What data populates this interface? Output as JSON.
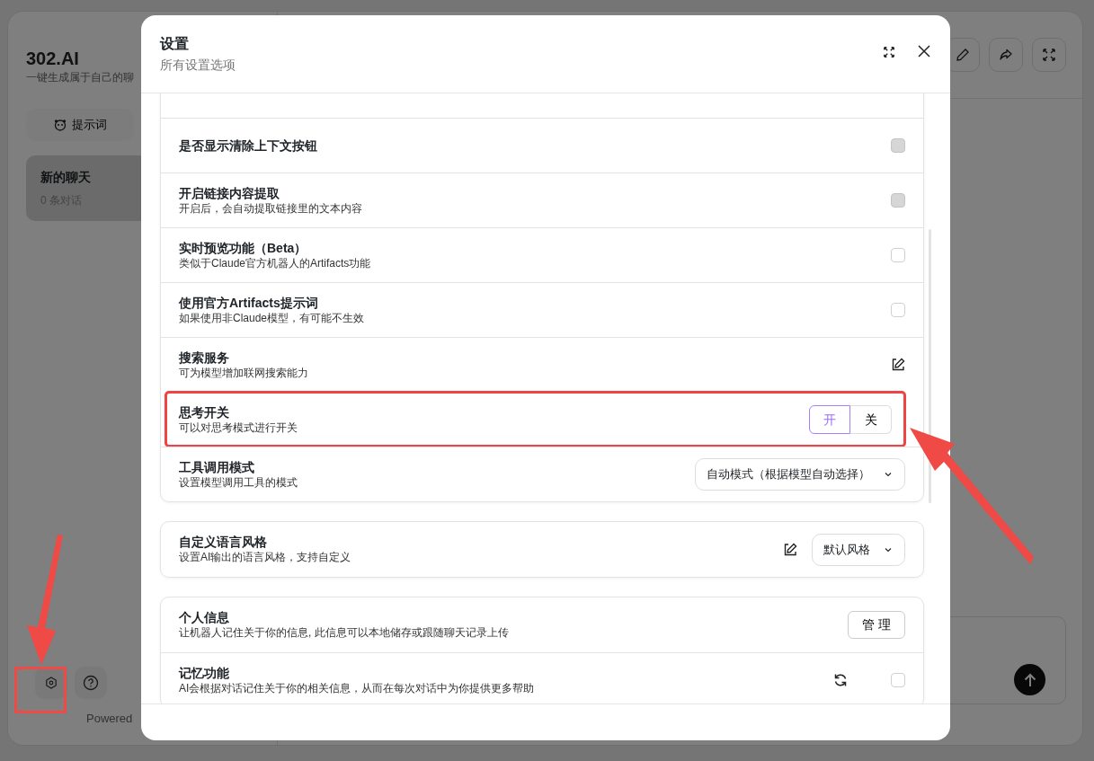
{
  "sidebar": {
    "title": "302.AI",
    "subtitle": "一键生成属于自己的聊",
    "prompt_button": "提示词",
    "chats": [
      {
        "title": "新的聊天",
        "count": "0 条对话",
        "selected": true
      }
    ],
    "footer": "Powered"
  },
  "dialog": {
    "title": "设置",
    "subtitle": "所有设置选项",
    "groups": [
      {
        "rows": [
          {
            "kind": "checkbox",
            "title": "是否显示清除上下文按钮",
            "checked": false,
            "disabled": true,
            "highlighted": false
          },
          {
            "kind": "checkbox",
            "title": "开启链接内容提取",
            "description": "开启后，会自动提取链接里的文本内容",
            "checked": false,
            "disabled": true,
            "highlighted": false
          },
          {
            "kind": "checkbox",
            "title": "实时预览功能（Beta）",
            "description": "类似于Claude官方机器人的Artifacts功能",
            "checked": false,
            "disabled": false,
            "highlighted": false
          },
          {
            "kind": "checkbox",
            "title": "使用官方Artifacts提示词",
            "description": "如果使用非Claude模型，有可能不生效",
            "checked": false,
            "disabled": false,
            "highlighted": false
          },
          {
            "kind": "edit",
            "title": "搜索服务",
            "description": "可为模型增加联网搜索能力",
            "highlighted": false
          },
          {
            "kind": "segmented",
            "title": "思考开关",
            "description": "可以对思考模式进行开关",
            "highlighted": true,
            "options": [
              {
                "label": "开",
                "selected": true
              },
              {
                "label": "关",
                "selected": false
              }
            ]
          },
          {
            "kind": "select",
            "title": "工具调用模式",
            "description": "设置模型调用工具的模式",
            "value": "自动模式（根据模型自动选择）",
            "highlighted": false
          }
        ]
      },
      {
        "rows": [
          {
            "kind": "edit_select",
            "title": "自定义语言风格",
            "description": "设置AI输出的语言风格，支持自定义",
            "value": "默认风格",
            "highlighted": false
          }
        ]
      },
      {
        "rows": [
          {
            "kind": "button",
            "title": "个人信息",
            "description": "让机器人记住关于你的信息, 此信息可以本地储存或跟随聊天记录上传",
            "button": "管 理",
            "highlighted": false
          },
          {
            "kind": "refresh_checkbox",
            "title": "记忆功能",
            "description": "AI会根据对话记住关于你的相关信息，从而在每次对话中为你提供更多帮助",
            "checked": false,
            "disabled": false,
            "highlighted": false
          }
        ]
      }
    ]
  }
}
